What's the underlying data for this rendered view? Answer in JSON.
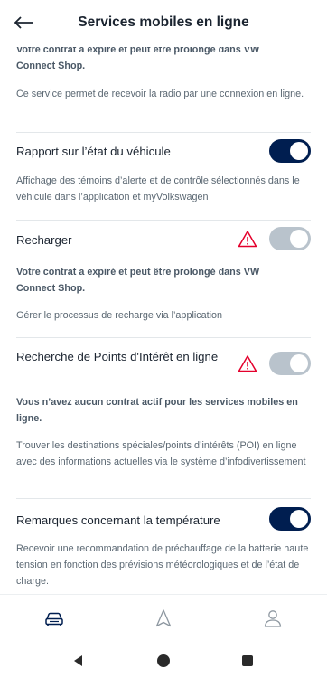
{
  "header": {
    "title": "Services mobiles en ligne"
  },
  "sections": [
    {
      "warning": "Votre contrat a expiré et peut être prolongé dans VW Connect Shop.",
      "description": "Ce service permet de recevoir la radio par une connexion en ligne."
    },
    {
      "title": "Rapport sur l’état du véhicule",
      "enabled": true,
      "description": "Affichage des témoins d’alerte et de contrôle sélectionnés dans le véhicule dans l’application et myVolkswagen"
    },
    {
      "title": "Recharger",
      "enabled": false,
      "warning": "Votre contrat a expiré et peut être prolongé dans VW Connect Shop.",
      "description": "Gérer le processus de recharge via l’application"
    },
    {
      "title": "Recherche de Points d'Intérêt en ligne",
      "enabled": false,
      "warning": "Vous n’avez aucun contrat actif pour les services mobiles en ligne.",
      "description": "Trouver les destinations spéciales/points d’intérêts (POI) en ligne avec des informations actuelles via le système d’infodivertissement"
    },
    {
      "title": "Remarques concernant la température",
      "enabled": true,
      "description": "Recevoir une recommandation de préchauffage de la batterie haute tension en fonction des prévisions météorologiques et de l’état de charge."
    }
  ],
  "colors": {
    "toggle_on": "#001e50",
    "toggle_off": "#b9c3cc",
    "warning": "#e4002c"
  },
  "icons": {
    "back": "arrow-left-icon",
    "nav": [
      "car-icon",
      "navigation-arrow-icon",
      "user-icon"
    ]
  }
}
